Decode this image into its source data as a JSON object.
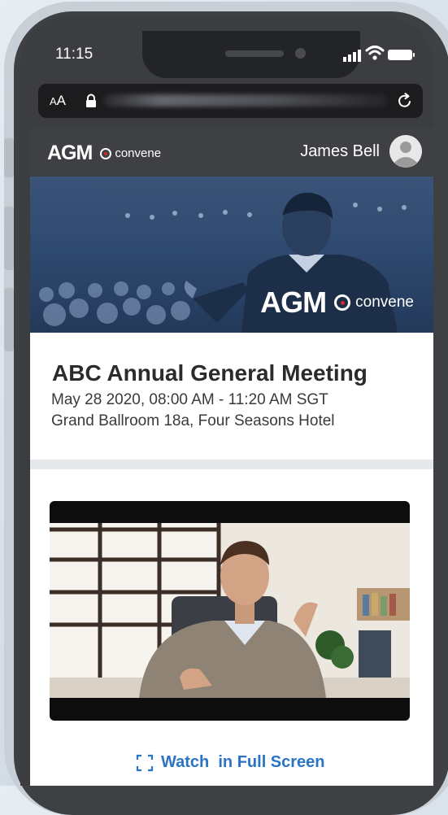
{
  "status_bar": {
    "time": "11:15"
  },
  "browser": {
    "text_size_label": "AA"
  },
  "header": {
    "logo_main": "AGM",
    "logo_brand": "convene",
    "user_name": "James Bell"
  },
  "hero": {
    "logo_main": "AGM",
    "logo_brand": "convene"
  },
  "meeting": {
    "title": "ABC Annual General Meeting",
    "datetime": "May 28 2020, 08:00 AM - 11:20 AM SGT",
    "location": "Grand Ballroom 18a, Four Seasons Hotel"
  },
  "video": {
    "fullscreen_label": "Watch  in Full Screen"
  },
  "colors": {
    "accent": "#2a73c6",
    "brand_red": "#d8262f",
    "header_bg": "#3f4044"
  }
}
